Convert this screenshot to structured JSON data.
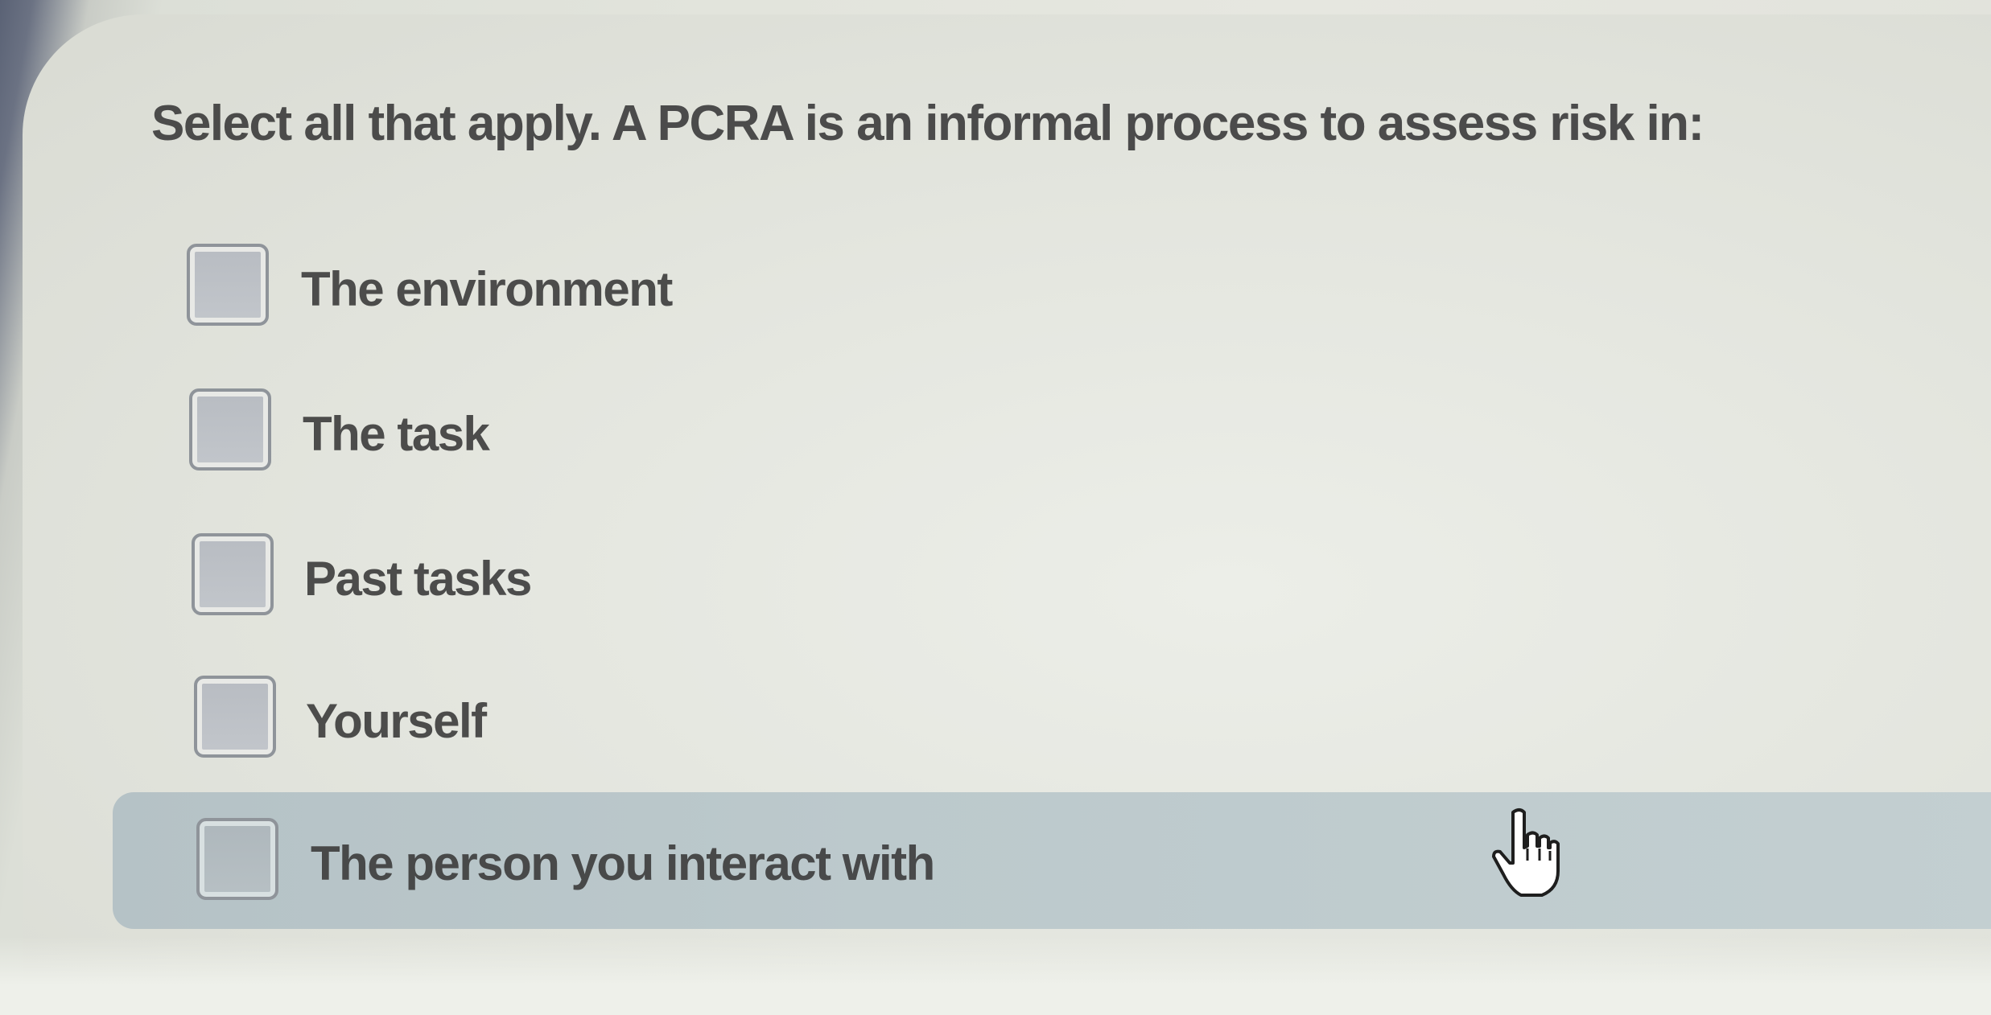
{
  "question": {
    "text": "Select all that apply. A PCRA is an informal process to assess risk in:"
  },
  "options": [
    {
      "label": "The environment",
      "checked": false,
      "highlighted": false
    },
    {
      "label": "The task",
      "checked": false,
      "highlighted": false
    },
    {
      "label": "Past tasks",
      "checked": false,
      "highlighted": false
    },
    {
      "label": "Yourself",
      "checked": false,
      "highlighted": false
    },
    {
      "label": "The person you interact with",
      "checked": false,
      "highlighted": true
    }
  ],
  "cursor": {
    "icon": "hand-pointer-icon"
  },
  "colors": {
    "highlight": "#bcc9cc",
    "background": "#e4e6df",
    "text": "#3c3c3c"
  }
}
